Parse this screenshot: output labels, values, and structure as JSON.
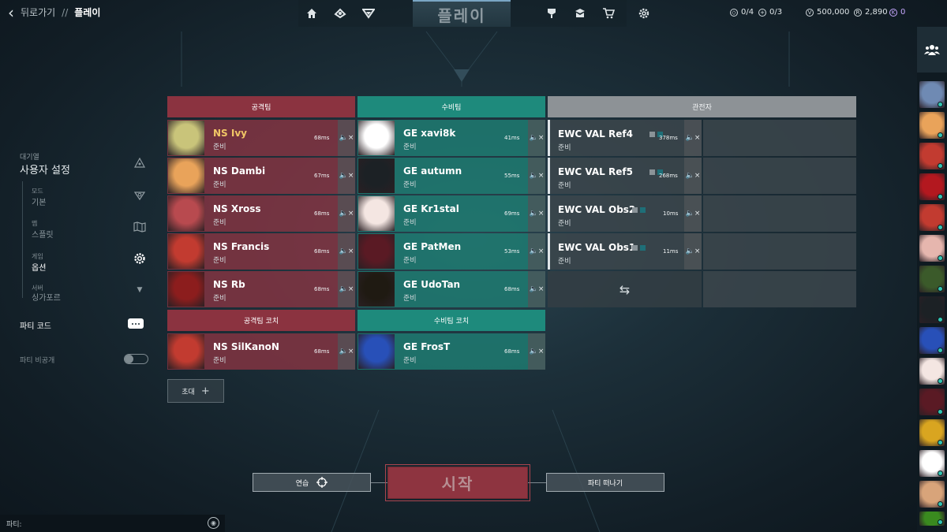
{
  "nav": {
    "back_label": "뒤로가기",
    "separator": "//",
    "current": "플레이",
    "tab_title": "플레이",
    "left_icons": [
      "home-icon",
      "career-icon",
      "battlepass-icon"
    ],
    "right_icons": [
      "agents-icon",
      "collection-icon",
      "store-icon",
      "settings-icon"
    ]
  },
  "resources": {
    "missions": "0/4",
    "daily": "0/3",
    "valorant_points": "500,000",
    "radianite": "2,890",
    "kingdom_credits": "0"
  },
  "sidebar": {
    "queue_label": "대기열",
    "queue_title": "사용자 설정",
    "settings": [
      {
        "label": "모드",
        "value": "기본",
        "icon": "mode-icon",
        "active": false
      },
      {
        "label": "맵",
        "value": "스플릿",
        "icon": "map-icon",
        "active": false
      },
      {
        "label": "게임",
        "value": "옵션",
        "icon": "gear-icon",
        "active": true
      },
      {
        "label": "서버",
        "value": "싱가포르",
        "icon": "chevron-down-icon",
        "active": false
      }
    ],
    "party_code": "파티 코드",
    "party_private": "파티 비공개"
  },
  "teams": {
    "attackers_header": "공격팀",
    "defenders_header": "수비팀",
    "spectators_header": "관전자",
    "attackers_coach_header": "공격팀 코치",
    "defenders_coach_header": "수비팀 코치",
    "attackers": [
      {
        "name": "NS Ivy",
        "status": "준비",
        "ping": "68ms",
        "highlight": true
      },
      {
        "name": "NS Dambi",
        "status": "준비",
        "ping": "67ms"
      },
      {
        "name": "NS Xross",
        "status": "준비",
        "ping": "68ms"
      },
      {
        "name": "NS Francis",
        "status": "준비",
        "ping": "68ms"
      },
      {
        "name": "NS Rb",
        "status": "준비",
        "ping": "68ms"
      }
    ],
    "defenders": [
      {
        "name": "GE xavi8k",
        "status": "준비",
        "ping": "41ms"
      },
      {
        "name": "GE autumn",
        "status": "준비",
        "ping": "55ms"
      },
      {
        "name": "GE Kr1stal",
        "status": "준비",
        "ping": "69ms"
      },
      {
        "name": "GE PatMen",
        "status": "준비",
        "ping": "53ms"
      },
      {
        "name": "GE UdoTan",
        "status": "준비",
        "ping": "68ms"
      }
    ],
    "attackers_coach": {
      "name": "NS SilKanoN",
      "status": "준비",
      "ping": "68ms"
    },
    "defenders_coach": {
      "name": "GE FrosT",
      "status": "준비",
      "ping": "68ms"
    },
    "spectators": [
      {
        "name": "EWC VAL Ref4",
        "status": "준비",
        "ping": "378ms"
      },
      {
        "name": "EWC VAL Ref5",
        "status": "준비",
        "ping": "268ms"
      },
      {
        "name": "EWC VAL Obs2",
        "status": "준비",
        "ping": "10ms"
      },
      {
        "name": "EWC VAL Obs1",
        "status": "준비",
        "ping": "11ms"
      }
    ],
    "mute_glyph": "🔈×",
    "swap_glyph": "⇆"
  },
  "actions": {
    "invite": "초대",
    "invite_plus": "+",
    "practice": "연습",
    "start": "시작",
    "leave": "파티 떠나기"
  },
  "chat": {
    "label": "파티:"
  },
  "colors": {
    "attackers": "#8b3340",
    "defenders": "#1e8a7c",
    "spectators": "#8d9296",
    "start": "#8e3440"
  }
}
